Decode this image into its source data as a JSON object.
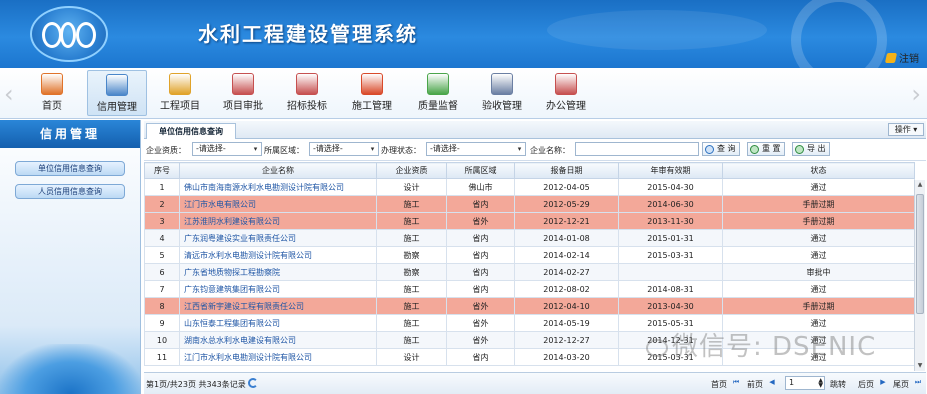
{
  "app": {
    "title": "水利工程建设管理系统",
    "logout": "注销"
  },
  "toolbar": {
    "items": [
      {
        "label": "首页",
        "icon": "home-icon",
        "color": "#e0732a"
      },
      {
        "label": "信用管理",
        "icon": "id-card-icon",
        "color": "#4a86c9"
      },
      {
        "label": "工程项目",
        "icon": "worker-icon",
        "color": "#e0a32a"
      },
      {
        "label": "项目审批",
        "icon": "document-approve-icon",
        "color": "#c65050"
      },
      {
        "label": "招标投标",
        "icon": "bid-document-icon",
        "color": "#c65050"
      },
      {
        "label": "施工管理",
        "icon": "warning-sign-icon",
        "color": "#d94a2a"
      },
      {
        "label": "质量监督",
        "icon": "checklist-icon",
        "color": "#4aa54a"
      },
      {
        "label": "验收管理",
        "icon": "acceptance-icon",
        "color": "#6b7fa3"
      },
      {
        "label": "办公管理",
        "icon": "office-document-icon",
        "color": "#c65050"
      }
    ]
  },
  "sidebar": {
    "title": "信用管理",
    "items": [
      "单位信用信息查询",
      "人员信用信息查询"
    ]
  },
  "tab": {
    "label": "单位信用信息查询",
    "ops": "操作"
  },
  "filters": {
    "qual_label": "企业资质：",
    "qual_value": "-请选择-",
    "area_label": "所属区域：",
    "area_value": "-请选择-",
    "status_label": "办理状态：",
    "status_value": "-请选择-",
    "name_label": "企业名称：",
    "name_value": "",
    "search": "查 询",
    "reset": "重 置",
    "export": "导 出"
  },
  "table": {
    "headers": [
      "序号",
      "企业名称",
      "企业资质",
      "所属区域",
      "报备日期",
      "年审有效期",
      "状态"
    ],
    "rows": [
      {
        "no": "1",
        "name": "佛山市南海南源水利水电勘测设计院有限公司",
        "qual": "设计",
        "area": "佛山市",
        "date": "2012-04-05",
        "expire": "2015-04-30",
        "status": "通过",
        "warn": false
      },
      {
        "no": "2",
        "name": "江门市水电有限公司",
        "qual": "施工",
        "area": "省内",
        "date": "2012-05-29",
        "expire": "2014-06-30",
        "status": "手册过期",
        "warn": true
      },
      {
        "no": "3",
        "name": "江苏淮阴水利建设有限公司",
        "qual": "施工",
        "area": "省外",
        "date": "2012-12-21",
        "expire": "2013-11-30",
        "status": "手册过期",
        "warn": true
      },
      {
        "no": "4",
        "name": "广东润粤建设实业有限责任公司",
        "qual": "施工",
        "area": "省内",
        "date": "2014-01-08",
        "expire": "2015-01-31",
        "status": "通过",
        "warn": false
      },
      {
        "no": "5",
        "name": "清远市水利水电勘测设计院有限公司",
        "qual": "勘察",
        "area": "省内",
        "date": "2014-02-14",
        "expire": "2015-03-31",
        "status": "通过",
        "warn": false
      },
      {
        "no": "6",
        "name": "广东省地质物探工程勘察院",
        "qual": "勘察",
        "area": "省内",
        "date": "2014-02-27",
        "expire": "",
        "status": "审批中",
        "warn": false
      },
      {
        "no": "7",
        "name": "广东钧意建筑集团有限公司",
        "qual": "施工",
        "area": "省内",
        "date": "2012-08-02",
        "expire": "2014-08-31",
        "status": "通过",
        "warn": false
      },
      {
        "no": "8",
        "name": "江西省新宇建设工程有限责任公司",
        "qual": "施工",
        "area": "省外",
        "date": "2012-04-10",
        "expire": "2013-04-30",
        "status": "手册过期",
        "warn": true
      },
      {
        "no": "9",
        "name": "山东恒泰工程集团有限公司",
        "qual": "施工",
        "area": "省外",
        "date": "2014-05-19",
        "expire": "2015-05-31",
        "status": "通过",
        "warn": false
      },
      {
        "no": "10",
        "name": "湖南水总水利水电建设有限公司",
        "qual": "施工",
        "area": "省外",
        "date": "2012-12-27",
        "expire": "2014-12-31",
        "status": "通过",
        "warn": false
      },
      {
        "no": "11",
        "name": "江门市水利水电勘测设计院有限公司",
        "qual": "设计",
        "area": "省内",
        "date": "2014-03-20",
        "expire": "2015-03-31",
        "status": "通过",
        "warn": false
      }
    ]
  },
  "pager": {
    "info": "第1页/共23页  共343条记录",
    "first": "首页",
    "prev": "前页",
    "page": "1",
    "jump": "跳转",
    "next": "后页",
    "last": "尾页"
  },
  "watermark": "微信号: DSENIC"
}
